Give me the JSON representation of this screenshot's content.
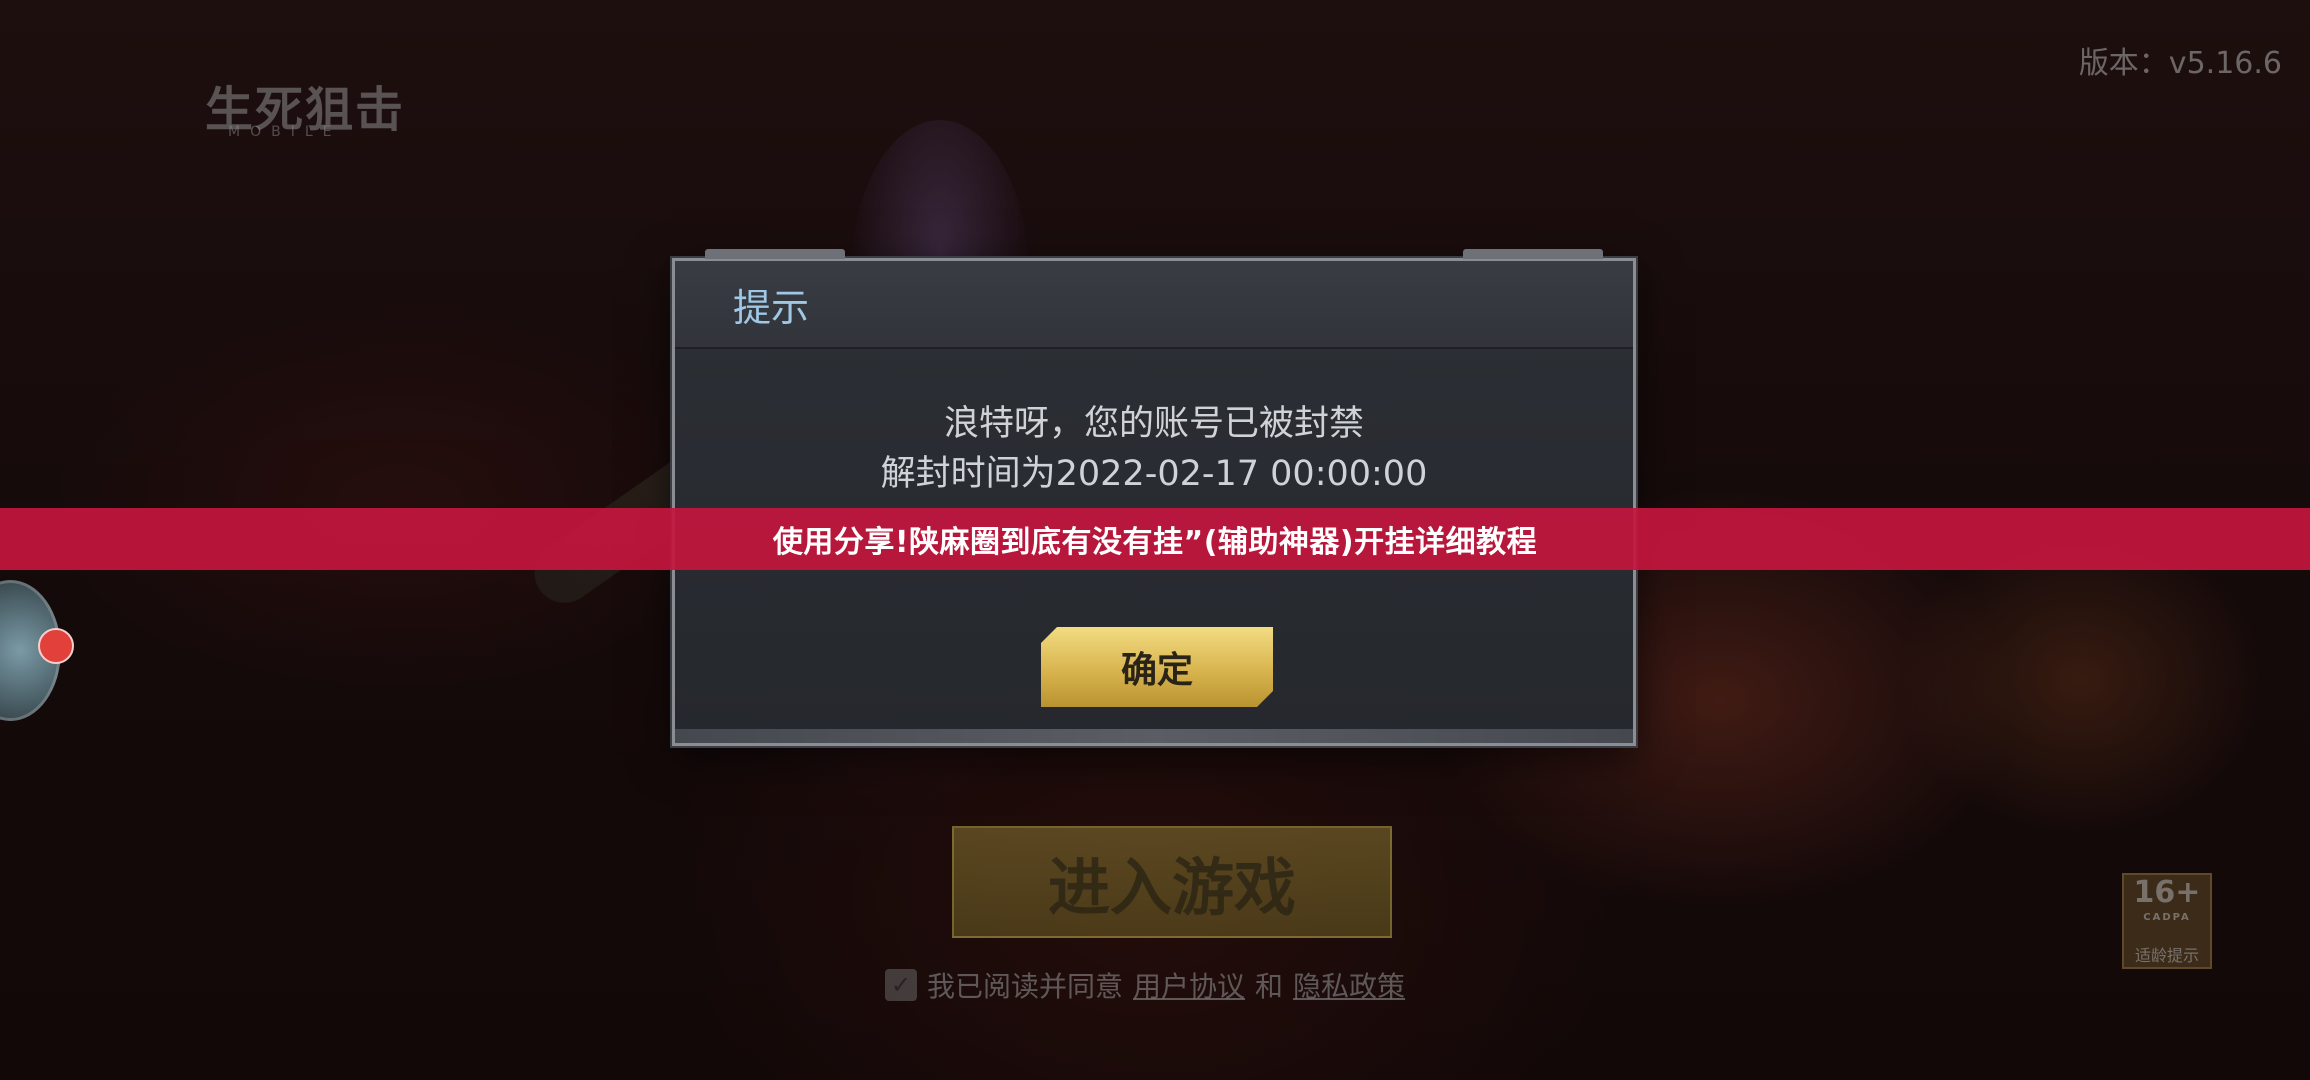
{
  "game": {
    "logo_text": "生死狙击",
    "logo_sub": "MOBILE",
    "version": "版本：v5.16.6",
    "enter_label": "进入游戏",
    "agree_text": "我已阅读并同意",
    "user_agreement": "用户协议",
    "and_text": "和",
    "privacy_policy": "隐私政策",
    "age_rating": "16+",
    "age_rating_sub": "CADPA",
    "age_rating_foot": "适龄提示"
  },
  "dialog": {
    "title": "提示",
    "message_line1": "浪特呀，您的账号已被封禁",
    "message_line2": "解封时间为2022-02-17 00:00:00",
    "confirm_label": "确定"
  },
  "banner": {
    "text": "使用分享!陕麻圈到底有没有挂”(辅助神器)开挂详细教程"
  },
  "colors": {
    "banner": "#c4163e",
    "dialog_title": "#9ec8e6",
    "confirm_button": "#d8b44f"
  },
  "icons": {
    "checkbox": "check-icon",
    "floating_assistant": "assistant-ball-icon"
  }
}
